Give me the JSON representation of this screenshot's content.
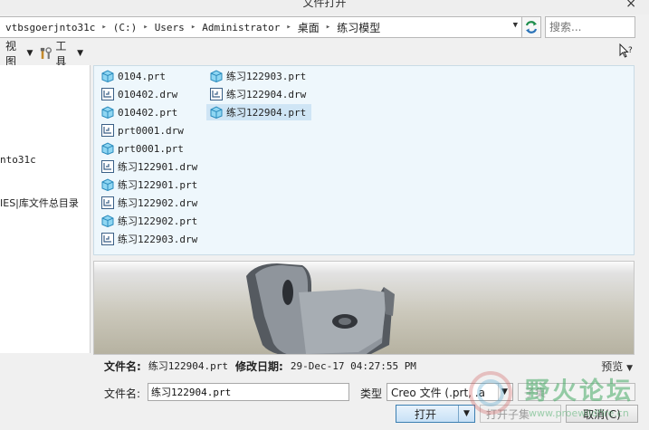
{
  "window": {
    "title": "文件打开",
    "close_glyph": "×"
  },
  "address": {
    "crumbs": [
      "vtbsgoerjnto31c",
      "(C:)",
      "Users",
      "Administrator",
      "桌面",
      "练习模型"
    ],
    "separator": "▸"
  },
  "search": {
    "placeholder": "搜索..."
  },
  "toolbar": {
    "view_label": "视图",
    "tools_label": "工具"
  },
  "sidebar": {
    "items": [
      "nto31c",
      "IES|库文件总目录"
    ]
  },
  "files": [
    {
      "name": "0104.prt",
      "type": "part"
    },
    {
      "name": "010402.drw",
      "type": "drawing"
    },
    {
      "name": "010402.prt",
      "type": "part"
    },
    {
      "name": "prt0001.drw",
      "type": "drawing"
    },
    {
      "name": "prt0001.prt",
      "type": "part"
    },
    {
      "name": "练习122901.drw",
      "type": "drawing"
    },
    {
      "name": "练习122901.prt",
      "type": "part"
    },
    {
      "name": "练习122902.drw",
      "type": "drawing"
    },
    {
      "name": "练习122902.prt",
      "type": "part"
    },
    {
      "name": "练习122903.drw",
      "type": "drawing"
    },
    {
      "name": "练习122903.prt",
      "type": "part"
    },
    {
      "name": "练习122904.drw",
      "type": "drawing"
    },
    {
      "name": "练习122904.prt",
      "type": "part",
      "selected": true
    }
  ],
  "info": {
    "filename_label": "文件名:",
    "filename_value": "练习122904.prt",
    "modified_label": "修改日期:",
    "modified_value": "29-Dec-17 04:27:55 PM",
    "preview_toggle": "预览"
  },
  "form": {
    "filename_label": "文件名:",
    "filename_value": "练习122904.prt",
    "type_label": "类型",
    "type_value": "Creo 文件 (.prt, .a",
    "subset_label": "子集"
  },
  "buttons": {
    "open": "打开",
    "open_subset": "打开子集",
    "cancel": "取消(C)"
  },
  "watermark": {
    "text": "野火论坛",
    "url": "www.proewildfire.cn"
  },
  "colors": {
    "selection": "#cfe5f5",
    "file_pane_bg": "#eef7fc",
    "part_icon": "#5fc0e8",
    "accent": "#2a73b8",
    "refresh_icon": "#1c8d4b"
  }
}
